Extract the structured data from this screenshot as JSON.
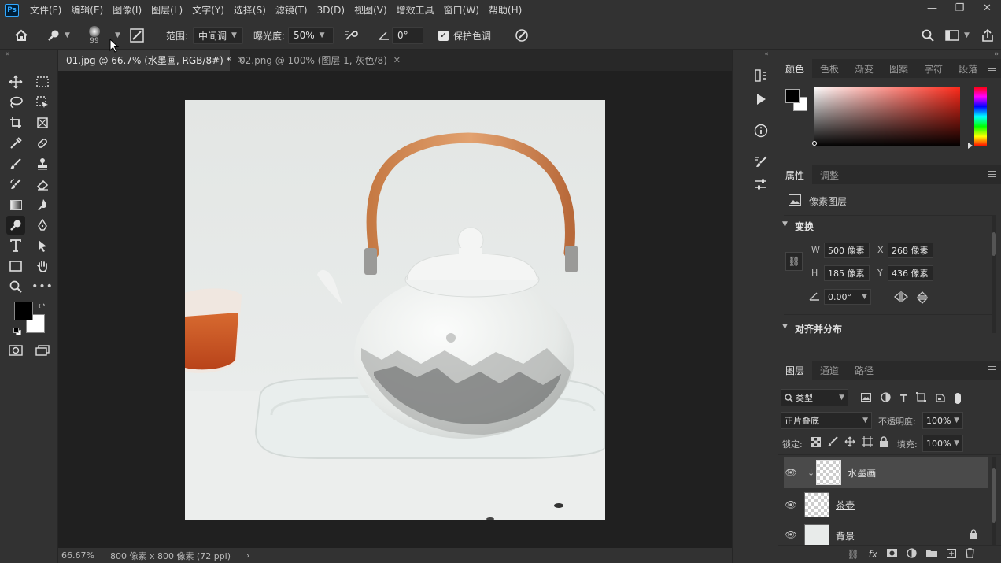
{
  "app": {
    "logo": "Ps"
  },
  "menu": [
    "文件(F)",
    "编辑(E)",
    "图像(I)",
    "图层(L)",
    "文字(Y)",
    "选择(S)",
    "滤镜(T)",
    "3D(D)",
    "视图(V)",
    "增效工具",
    "窗口(W)",
    "帮助(H)"
  ],
  "window_controls": {
    "minimize": "—",
    "restore": "❐",
    "close": "✕"
  },
  "options": {
    "brush_size": "99",
    "range_label": "范围:",
    "range_value": "中间调",
    "exposure_label": "曝光度:",
    "exposure_value": "50%",
    "angle_value": "0°",
    "protect_tones_label": "保护色调",
    "protect_tones_checked": true
  },
  "tabs": [
    {
      "label": "01.jpg @ 66.7% (水墨画, RGB/8#) *",
      "active": true
    },
    {
      "label": "02.png @ 100% (图层 1, 灰色/8)",
      "active": false
    }
  ],
  "status": {
    "zoom": "66.67%",
    "doc_info": "800 像素 x 800 像素 (72 ppi)",
    "arrow": "›"
  },
  "color_panel": {
    "tabs": [
      "颜色",
      "色板",
      "渐变",
      "图案",
      "字符",
      "段落"
    ],
    "active_tab": "颜色",
    "foreground": "#000000",
    "background": "#ffffff",
    "picker_hue": "#ff2a1a"
  },
  "properties_panel": {
    "tabs": [
      "属性",
      "调整"
    ],
    "active_tab": "属性",
    "type_label": "像素图层",
    "transform_title": "变换",
    "w_label": "W",
    "w_value": "500 像素",
    "x_label": "X",
    "x_value": "268 像素",
    "h_label": "H",
    "h_value": "185 像素",
    "y_label": "Y",
    "y_value": "436 像素",
    "angle_value": "0.00°",
    "align_title": "对齐并分布"
  },
  "layers_panel": {
    "tabs": [
      "图层",
      "通道",
      "路径"
    ],
    "active_tab": "图层",
    "filter_value": "类型",
    "blend_mode": "正片叠底",
    "opacity_label": "不透明度:",
    "opacity_value": "100%",
    "lock_label": "锁定:",
    "fill_label": "填充:",
    "fill_value": "100%",
    "layers": [
      {
        "name": "水墨画",
        "selected": true,
        "clipped": true
      },
      {
        "name": "茶壶",
        "selected": false,
        "clipped": false
      },
      {
        "name": "背景",
        "selected": false,
        "locked": true
      }
    ]
  }
}
